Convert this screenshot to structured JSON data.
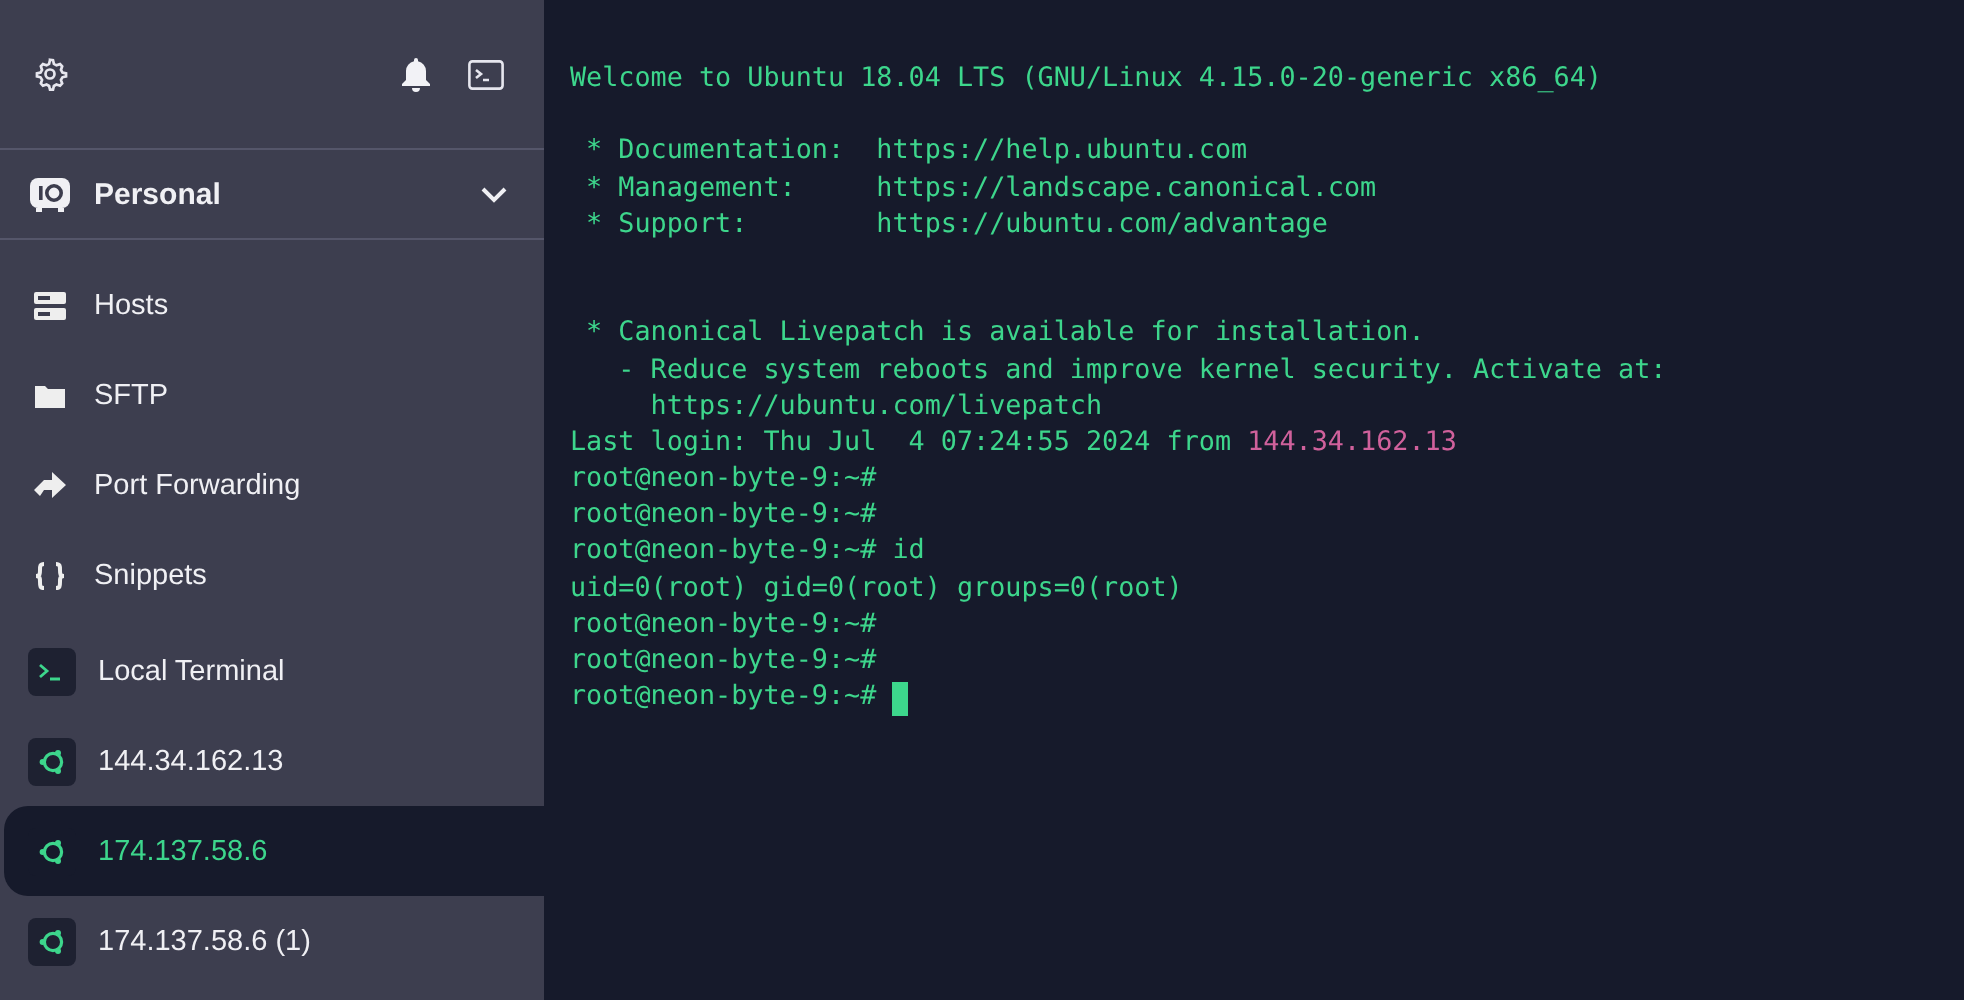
{
  "sidebar": {
    "vault": {
      "name": "Personal",
      "expanded": false
    },
    "nav": [
      {
        "kind": "hosts",
        "label": "Hosts"
      },
      {
        "kind": "sftp",
        "label": "SFTP"
      },
      {
        "kind": "forward",
        "label": "Port Forwarding"
      },
      {
        "kind": "snippets",
        "label": "Snippets"
      }
    ],
    "sessions": [
      {
        "kind": "local",
        "label": "Local Terminal",
        "selected": false
      },
      {
        "kind": "ubuntu",
        "label": "144.34.162.13",
        "selected": false
      },
      {
        "kind": "ubuntu",
        "label": "174.137.58.6",
        "selected": true
      },
      {
        "kind": "ubuntu",
        "label": "174.137.58.6 (1)",
        "selected": false
      }
    ]
  },
  "terminal": {
    "cursor": true,
    "lines": [
      {
        "kind": "output",
        "text": "Welcome to Ubuntu 18.04 LTS (GNU/Linux 4.15.0-20-generic x86_64)"
      },
      {
        "kind": "blank"
      },
      {
        "kind": "output",
        "text": " * Documentation:  https://help.ubuntu.com"
      },
      {
        "kind": "output",
        "text": " * Management:     https://landscape.canonical.com"
      },
      {
        "kind": "output",
        "text": " * Support:        https://ubuntu.com/advantage"
      },
      {
        "kind": "blank"
      },
      {
        "kind": "blank"
      },
      {
        "kind": "output",
        "text": " * Canonical Livepatch is available for installation."
      },
      {
        "kind": "output",
        "text": "   - Reduce system reboots and improve kernel security. Activate at:"
      },
      {
        "kind": "output",
        "text": "     https://ubuntu.com/livepatch"
      },
      {
        "kind": "login",
        "text": "Last login: Thu Jul  4 07:24:55 2024 from",
        "host": "144.34.162.13"
      },
      {
        "kind": "output",
        "text": "root@neon-byte-9:~#"
      },
      {
        "kind": "output",
        "text": "root@neon-byte-9:~#"
      },
      {
        "kind": "output",
        "text": "root@neon-byte-9:~# id"
      },
      {
        "kind": "output",
        "text": "uid=0(root) gid=0(root) groups=0(root)"
      },
      {
        "kind": "output",
        "text": "root@neon-byte-9:~#"
      },
      {
        "kind": "output",
        "text": "root@neon-byte-9:~#"
      },
      {
        "kind": "output",
        "text": "root@neon-byte-9:~#"
      }
    ]
  }
}
